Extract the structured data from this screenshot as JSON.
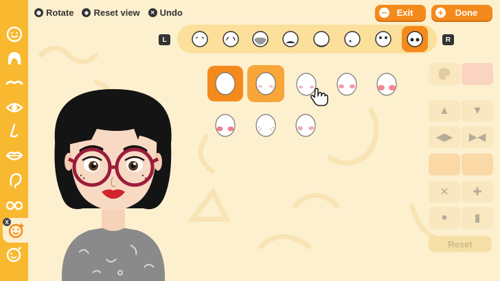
{
  "hints": [
    {
      "icon": "right-stick-icon",
      "label": "Rotate"
    },
    {
      "icon": "right-stick-press-icon",
      "label": "Reset view"
    },
    {
      "icon": "x-button-icon",
      "label": "Undo"
    }
  ],
  "buttons": {
    "exit": {
      "symbol": "−",
      "label": "Exit"
    },
    "done": {
      "symbol": "+",
      "label": "Done"
    },
    "l_shoulder": "L",
    "r_shoulder": "R",
    "reset": "Reset",
    "x_badge": "X"
  },
  "sidebar": {
    "items": [
      {
        "icon": "face-shape-icon"
      },
      {
        "icon": "hair-icon"
      },
      {
        "icon": "eyebrows-icon"
      },
      {
        "icon": "eye-icon"
      },
      {
        "icon": "nose-icon"
      },
      {
        "icon": "mouth-icon"
      },
      {
        "icon": "ear-icon"
      },
      {
        "icon": "glasses-icon"
      },
      {
        "icon": "makeup-icon",
        "active": true
      },
      {
        "icon": "face-paint-icon"
      }
    ]
  },
  "style_bar": {
    "options": [
      {
        "icon": "face-wrinkle-brow-icon"
      },
      {
        "icon": "face-crease-cheek-icon"
      },
      {
        "icon": "face-beard-gray-icon"
      },
      {
        "icon": "face-bangs-icon"
      },
      {
        "icon": "face-chin-beard-icon"
      },
      {
        "icon": "face-mole-icon"
      },
      {
        "icon": "face-eyes-small-icon"
      },
      {
        "icon": "face-eyes-large-icon",
        "selected": true
      }
    ]
  },
  "cheek_options": [
    {
      "variant": "none",
      "selected": true
    },
    {
      "variant": "pink-blush-light",
      "hover": true
    },
    {
      "variant": "pink-blush-small"
    },
    {
      "variant": "pink-blush-medium"
    },
    {
      "variant": "pink-blush-large"
    },
    {
      "variant": "red-blush-low"
    },
    {
      "variant": "freckles"
    },
    {
      "variant": "freckles-blush"
    }
  ],
  "colors": {
    "accent": "#f48a1c",
    "sidebar": "#f8b830",
    "background": "#fdf0cf"
  }
}
